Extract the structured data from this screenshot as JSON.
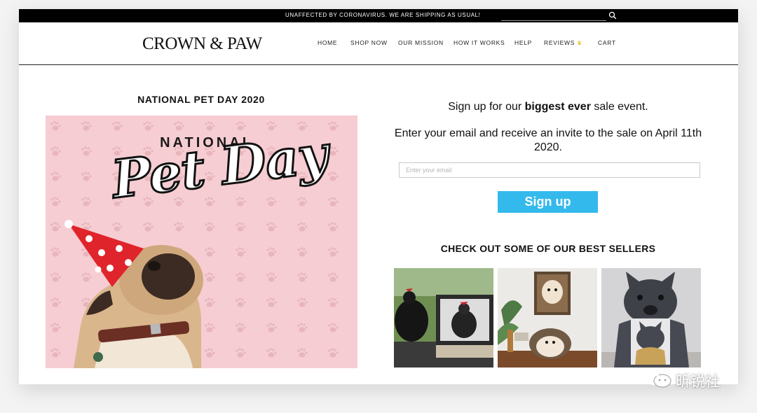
{
  "announcement": "UNAFFECTED BY CORONAVIRUS. WE ARE SHIPPING AS USUAL!",
  "search": {
    "placeholder": ""
  },
  "brand": {
    "logo": "CROWN & PAW"
  },
  "nav": {
    "home": "HOME",
    "shop_now": "SHOP NOW",
    "our_mission": "OUR MISSION",
    "how_it_works": "HOW IT WORKS",
    "help": "HELP",
    "reviews": "REVIEWS",
    "reviews_icon": "crown-icon",
    "cart": "CART"
  },
  "promo": {
    "heading": "NATIONAL PET DAY 2020",
    "banner_top": "NATIONAL",
    "banner_script": "Pet Day"
  },
  "signup": {
    "line1_prefix": "Sign up for our ",
    "line1_bold": "biggest ever",
    "line1_suffix": " sale event.",
    "line2": "Enter your email and receive an invite to the sale on April 11th 2020.",
    "email_placeholder": "Enter your email",
    "button": "Sign up"
  },
  "best_sellers": {
    "heading": "CHECK OUT SOME OF OUR BEST SELLERS",
    "items": [
      {
        "icon": "chicken-portrait-image"
      },
      {
        "icon": "hedgehog-portrait-image"
      },
      {
        "icon": "french-bulldog-portrait-image"
      }
    ]
  },
  "watermark": {
    "text": "昕锐社",
    "icon": "wechat-icon"
  },
  "colors": {
    "announcement_bg": "#000000",
    "button_bg": "#34b9ec",
    "banner_bg": "#f6cdd2",
    "party_hat": "#e0242c"
  }
}
